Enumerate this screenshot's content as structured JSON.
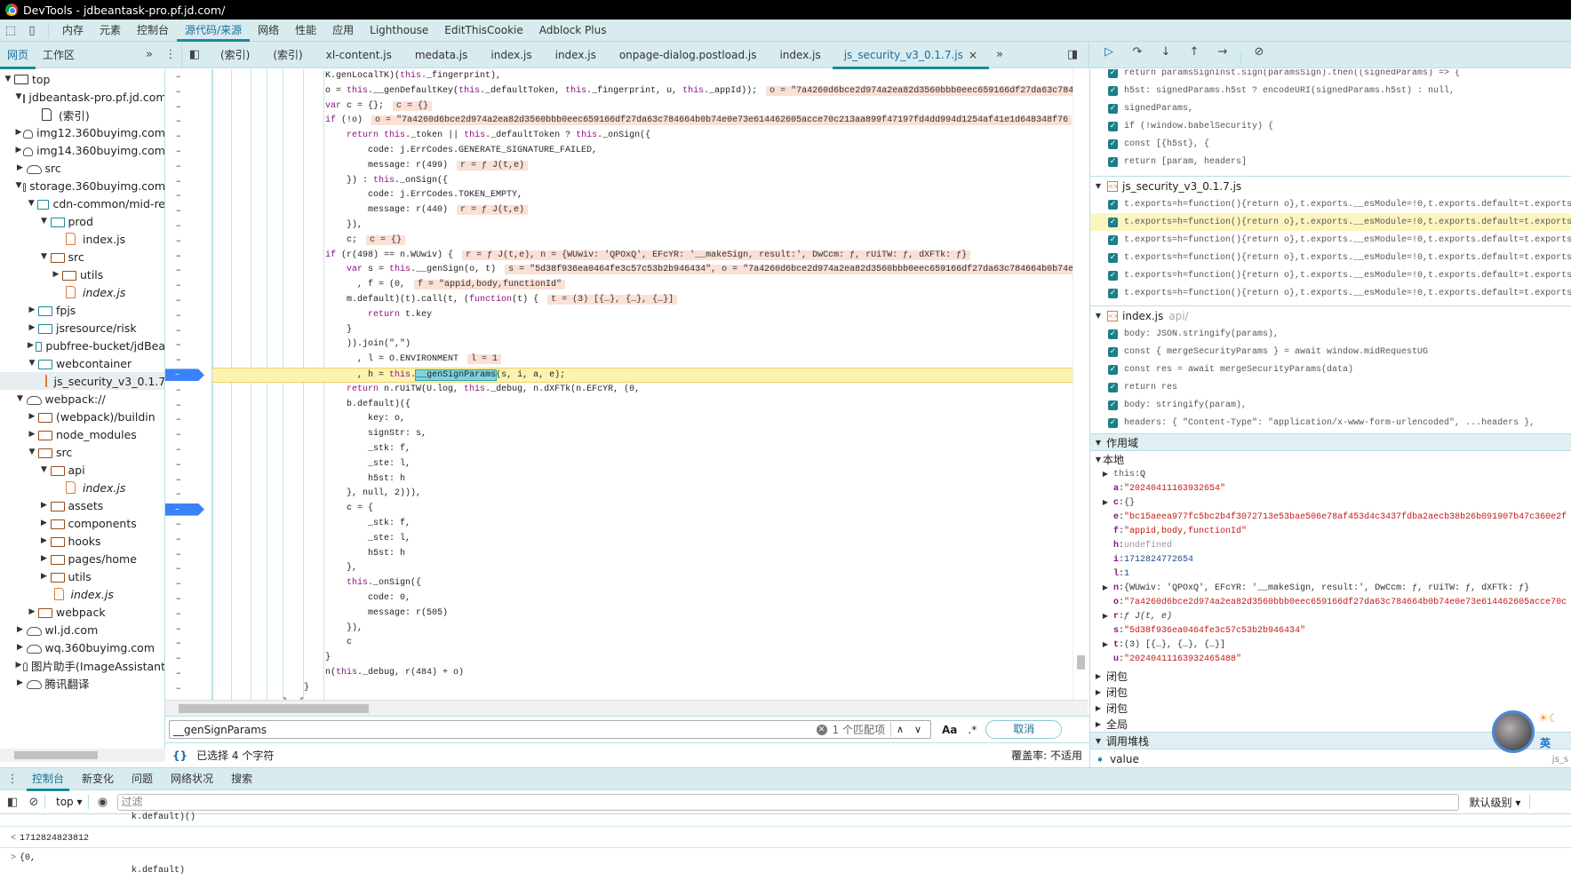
{
  "window": {
    "title": "DevTools - jdbeantask-pro.pf.jd.com/"
  },
  "main_tabs": [
    {
      "label": "内存"
    },
    {
      "label": "元素"
    },
    {
      "label": "控制台"
    },
    {
      "label": "源代码/来源",
      "selected": true
    },
    {
      "label": "网络"
    },
    {
      "label": "性能"
    },
    {
      "label": "应用"
    },
    {
      "label": "Lighthouse"
    },
    {
      "label": "EditThisCookie"
    },
    {
      "label": "Adblock Plus"
    }
  ],
  "navigator_tabs": [
    {
      "label": "网页",
      "selected": true
    },
    {
      "label": "工作区"
    }
  ],
  "more_label": "»",
  "editor_tabs": [
    {
      "label": "(索引)"
    },
    {
      "label": "(索引)"
    },
    {
      "label": "xl-content.js"
    },
    {
      "label": "medata.js"
    },
    {
      "label": "index.js"
    },
    {
      "label": "index.js"
    },
    {
      "label": "onpage-dialog.postload.js"
    },
    {
      "label": "index.js"
    },
    {
      "label": "js_security_v3_0.1.7.js",
      "selected": true,
      "closable": true
    }
  ],
  "close_glyph": "×",
  "tree": [
    {
      "label": "top",
      "level": 0,
      "type": "frame",
      "expanded": true
    },
    {
      "label": "jdbeantask-pro.pf.jd.com",
      "level": 1,
      "type": "cloud",
      "expanded": true
    },
    {
      "label": "(索引)",
      "level": 2,
      "type": "file-plain"
    },
    {
      "label": "img12.360buyimg.com",
      "level": 1,
      "type": "cloud",
      "expanded": false
    },
    {
      "label": "img14.360buyimg.com",
      "level": 1,
      "type": "cloud",
      "expanded": false
    },
    {
      "label": "src",
      "level": 1,
      "type": "cloud",
      "expanded": false
    },
    {
      "label": "storage.360buyimg.com",
      "level": 1,
      "type": "cloud",
      "expanded": true
    },
    {
      "label": "cdn-common/mid-re",
      "level": 2,
      "type": "folder",
      "expanded": true
    },
    {
      "label": "prod",
      "level": 3,
      "type": "folder",
      "expanded": true
    },
    {
      "label": "index.js",
      "level": 4,
      "type": "file"
    },
    {
      "label": "src",
      "level": 3,
      "type": "folder-brown",
      "expanded": true
    },
    {
      "label": "utils",
      "level": 4,
      "type": "folder-brown",
      "expanded": false
    },
    {
      "label": "index.js",
      "level": 4,
      "type": "file",
      "italic": true
    },
    {
      "label": "fpjs",
      "level": 2,
      "type": "folder",
      "expanded": false
    },
    {
      "label": "jsresource/risk",
      "level": 2,
      "type": "folder",
      "expanded": false
    },
    {
      "label": "pubfree-bucket/jdBea",
      "level": 2,
      "type": "folder",
      "expanded": false
    },
    {
      "label": "webcontainer",
      "level": 2,
      "type": "folder",
      "expanded": true
    },
    {
      "label": "js_security_v3_0.1.7.js",
      "level": 3,
      "type": "file",
      "selected": true
    },
    {
      "label": "webpack://",
      "level": 1,
      "type": "cloud",
      "expanded": true
    },
    {
      "label": "(webpack)/buildin",
      "level": 2,
      "type": "folder-brown",
      "expanded": false
    },
    {
      "label": "node_modules",
      "level": 2,
      "type": "folder-brown",
      "expanded": false
    },
    {
      "label": "src",
      "level": 2,
      "type": "folder-brown",
      "expanded": true
    },
    {
      "label": "api",
      "level": 3,
      "type": "folder-brown",
      "expanded": true
    },
    {
      "label": "index.js",
      "level": 4,
      "type": "file",
      "italic": true
    },
    {
      "label": "assets",
      "level": 3,
      "type": "folder-brown",
      "expanded": false
    },
    {
      "label": "components",
      "level": 3,
      "type": "folder-brown",
      "expanded": false
    },
    {
      "label": "hooks",
      "level": 3,
      "type": "folder-brown",
      "expanded": false
    },
    {
      "label": "pages/home",
      "level": 3,
      "type": "folder-brown",
      "expanded": false
    },
    {
      "label": "utils",
      "level": 3,
      "type": "folder-brown",
      "expanded": false
    },
    {
      "label": "index.js",
      "level": 3,
      "type": "file",
      "italic": true
    },
    {
      "label": "webpack",
      "level": 2,
      "type": "folder-brown",
      "expanded": false
    },
    {
      "label": "wl.jd.com",
      "level": 1,
      "type": "cloud",
      "expanded": false
    },
    {
      "label": "wq.360buyimg.com",
      "level": 1,
      "type": "cloud",
      "expanded": false
    },
    {
      "label": "图片助手(ImageAssistant",
      "level": 1,
      "type": "cloud",
      "expanded": false
    },
    {
      "label": "腾讯翻译",
      "level": 1,
      "type": "cloud",
      "expanded": false
    }
  ],
  "code": {
    "current_line": 20,
    "breakpoint_lines": [
      20,
      29
    ],
    "gutter_glyph": "–",
    "search_highlight": "__genSignParams",
    "lines": [
      {
        "text": "        K.genLocalTK)(this._fingerprint),"
      },
      {
        "text": "        o = this.__genDefaultKey(this._defaultToken, this._fingerprint, u, this._appId));",
        "annot": "o = \"7a4260d6bce2d974a2ea82d3560bbb0eec659166df27da63c784664b0b74e0e73e614462605acce70c213aa899f47197fd4dd994d1254af41e1d648348f76"
      },
      {
        "text": "        var c = {};",
        "annot": "c = {}"
      },
      {
        "text": "        if (!o)",
        "annot": "o = \"7a4260d6bce2d974a2ea82d3560bbb0eec659166df27da63c784664b0b74e0e73e614462605acce70c213aa899f47197fd4dd994d1254af41e1d648348f76"
      },
      {
        "text": "            return this._token || this._defaultToken ? this._onSign({"
      },
      {
        "text": "                code: j.ErrCodes.GENERATE_SIGNATURE_FAILED,"
      },
      {
        "text": "                message: r(499)",
        "annot": "r = ƒ J(t,e)"
      },
      {
        "text": "            }) : this._onSign({"
      },
      {
        "text": "                code: j.ErrCodes.TOKEN_EMPTY,"
      },
      {
        "text": "                message: r(440)",
        "annot": "r = ƒ J(t,e)"
      },
      {
        "text": "            }),"
      },
      {
        "text": "            c;",
        "annot": "c = {}"
      },
      {
        "text": "        if (r(498) == n.WUwiv) {",
        "annot": "r = ƒ J(t,e), n = {WUwiv: 'QPOxQ', EFcYR: '__makeSign, result:', DwCcm: ƒ, rUiTW: ƒ, dXFTk: ƒ}"
      },
      {
        "text": "            var s = this.__genSign(o, t)",
        "annot": "s = \"5d38f936ea0464fe3c57c53b2b946434\", o = \"7a4260d6bce2d974a2ea82d3560bbb0eec659166df27da63c784664b0b74e"
      },
      {
        "text": "              , f = (0,",
        "annot": "f = \"appid,body,functionId\""
      },
      {
        "text": "            m.default)(t).call(t, (function(t) {",
        "annot": "t = (3) [{…}, {…}, {…}]"
      },
      {
        "text": "                return t.key"
      },
      {
        "text": "            }"
      },
      {
        "text": "            )).join(\",\")"
      },
      {
        "text": "              , l = O.ENVIRONMENT",
        "annot": "l = 1"
      },
      {
        "text": "              , h = this.__genSignParams(s, i, a, e);"
      },
      {
        "text": "            return n.rUiTW(U.log, this._debug, n.dXFTk(n.EFcYR, (0,"
      },
      {
        "text": "            b.default)({"
      },
      {
        "text": "                key: o,"
      },
      {
        "text": "                signStr: s,"
      },
      {
        "text": "                _stk: f,"
      },
      {
        "text": "                _ste: l,"
      },
      {
        "text": "                h5st: h"
      },
      {
        "text": "            }, null, 2))),"
      },
      {
        "text": "            c = {"
      },
      {
        "text": "                _stk: f,"
      },
      {
        "text": "                _ste: l,"
      },
      {
        "text": "                h5st: h"
      },
      {
        "text": "            },"
      },
      {
        "text": "            this._onSign({"
      },
      {
        "text": "                code: 0,"
      },
      {
        "text": "                message: r(505)"
      },
      {
        "text": "            }),"
      },
      {
        "text": "            c"
      },
      {
        "text": "        }"
      },
      {
        "text": "        n(this._debug, r(484) + o)"
      },
      {
        "text": "    }"
      },
      {
        "text": "}, {"
      }
    ]
  },
  "search": {
    "value": "__genSignParams",
    "matches": "1 个匹配项",
    "case_label": "Aa",
    "regex_label": ".*",
    "cancel_label": "取消"
  },
  "status": {
    "selection": "已选择 4 个字符",
    "coverage": "覆盖率: 不适用",
    "braces": "{}"
  },
  "breakpoints": {
    "ungrouped": [
      "return paramsSignInst.sign(paramsSign).then((signedParams) => {",
      "h5st: signedParams.h5st ? encodeURI(signedParams.h5st) : null,",
      "signedParams,",
      "if (!window.babelSecurity) {",
      "const [{h5st}, {",
      "return [param, headers]"
    ],
    "groups": [
      {
        "file": "js_security_v3_0.1.7.js",
        "path": "",
        "highlight_index": 1,
        "items": [
          "t.exports=h=function(){return o},t.exports.__esModule=!0,t.exports.default=t.exports",
          "t.exports=h=function(){return o},t.exports.__esModule=!0,t.exports.default=t.exports",
          "t.exports=h=function(){return o},t.exports.__esModule=!0,t.exports.default=t.exports",
          "t.exports=h=function(){return o},t.exports.__esModule=!0,t.exports.default=t.exports",
          "t.exports=h=function(){return o},t.exports.__esModule=!0,t.exports.default=t.exports",
          "t.exports=h=function(){return o},t.exports.__esModule=!0,t.exports.default=t.exports"
        ]
      },
      {
        "file": "index.js",
        "path": "api/",
        "items": [
          "body: JSON.stringify(params),",
          "const { mergeSecurityParams } = await window.midRequestUG",
          "const res = await mergeSecurityParams(data)",
          "return res",
          "body: stringify(param),",
          "headers: { \"Content-Type\": \"application/x-www-form-urlencoded\", ...headers },"
        ]
      }
    ]
  },
  "scope": {
    "title": "作用域",
    "local_title": "本地",
    "vars": [
      {
        "name": "this",
        "value": "Q",
        "kind": "object",
        "expandable": true,
        "plain": true
      },
      {
        "name": "a",
        "value": "\"20240411163932654\"",
        "kind": "string"
      },
      {
        "name": "c",
        "value": "{}",
        "kind": "object",
        "expandable": true
      },
      {
        "name": "e",
        "value": "\"bc15aeea977fc5bc2b4f3072713e53bae506e78af453d4c3437fdba2aecb38b26b091907b47c360e2f",
        "kind": "string"
      },
      {
        "name": "f",
        "value": "\"appid,body,functionId\"",
        "kind": "string"
      },
      {
        "name": "h",
        "value": "undefined",
        "kind": "undefined"
      },
      {
        "name": "i",
        "value": "1712824772654",
        "kind": "number"
      },
      {
        "name": "l",
        "value": "1",
        "kind": "number"
      },
      {
        "name": "n",
        "value": "{WUwiv: 'QPOxQ', EFcYR: '__makeSign, result:', DwCcm: ƒ, rUiTW: ƒ, dXFTk: ƒ}",
        "kind": "object",
        "expandable": true
      },
      {
        "name": "o",
        "value": "\"7a4260d6bce2d974a2ea82d3560bbb0eec659166df27da63c784664b0b74e0e73e614462605acce70c",
        "kind": "string"
      },
      {
        "name": "r",
        "value": "ƒ J(t, e)",
        "kind": "function",
        "expandable": true
      },
      {
        "name": "s",
        "value": "\"5d38f936ea0464fe3c57c53b2b946434\"",
        "kind": "string"
      },
      {
        "name": "t",
        "value": "(3) [{…}, {…}, {…}]",
        "kind": "object",
        "expandable": true
      },
      {
        "name": "u",
        "value": "\"20240411163932465488\"",
        "kind": "string"
      }
    ],
    "closures": [
      "闭包",
      "闭包",
      "闭包"
    ],
    "global": "全局"
  },
  "callstack": {
    "title": "调用堆栈",
    "frames": [
      {
        "name": "value",
        "location": "js_s"
      }
    ]
  },
  "drawer": {
    "tabs": [
      {
        "label": "控制台",
        "selected": true
      },
      {
        "label": "新变化"
      },
      {
        "label": "问题"
      },
      {
        "label": "网络状况"
      },
      {
        "label": "搜索"
      }
    ],
    "context": "top",
    "filter_placeholder": "过滤",
    "level": "默认级别"
  },
  "console": [
    {
      "prefix": "",
      "text": "                      k.default)()"
    },
    {
      "prefix": "<",
      "text": " 1712824823812"
    },
    {
      "prefix": ">",
      "text": " {0,"
    },
    {
      "prefix": "",
      "text": "                      k.default)"
    }
  ],
  "widget": {
    "ime_label": "英"
  },
  "colors": {
    "accent": "#1a8a96",
    "breakpoint": "#3b82f6",
    "current_line": "#fdf3b0",
    "annotation": "#fbe0d6"
  }
}
